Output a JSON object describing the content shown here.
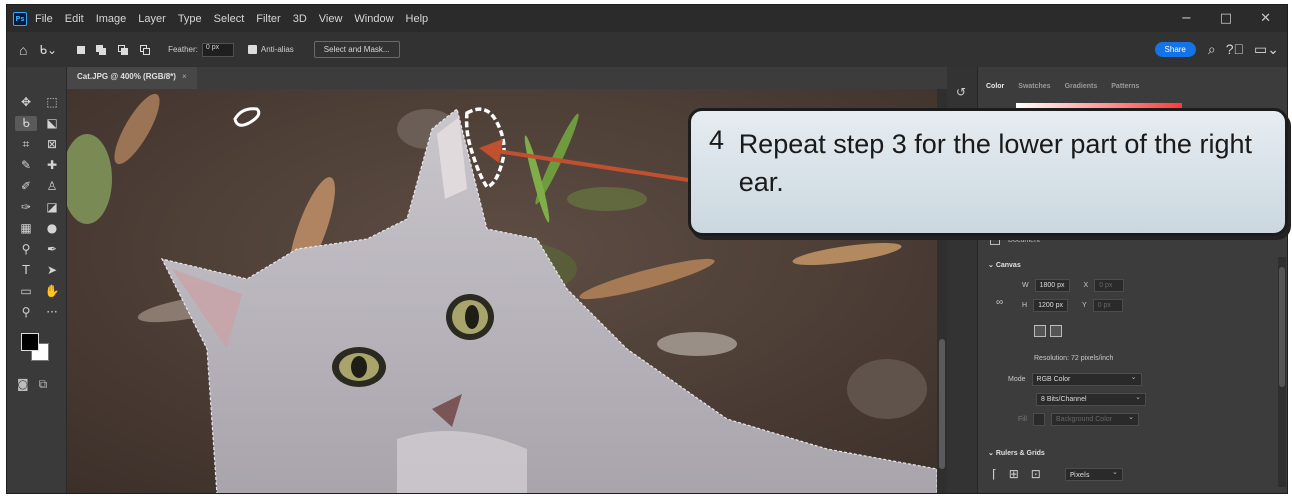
{
  "app": {
    "logo": "Ps",
    "menu": [
      "File",
      "Edit",
      "Image",
      "Layer",
      "Type",
      "Select",
      "Filter",
      "3D",
      "View",
      "Window",
      "Help"
    ],
    "window_controls": [
      "−",
      "□",
      "✕"
    ]
  },
  "options_bar": {
    "feather_label": "Feather:",
    "feather_value": "0 px",
    "anti_alias_label": "Anti-alias",
    "select_mask_label": "Select and Mask...",
    "share_label": "Share"
  },
  "document": {
    "tab_title": "Cat.JPG @ 400% (RGB/8*)",
    "tab_close": "×"
  },
  "panel": {
    "tabs": [
      "Color",
      "Swatches",
      "Gradients",
      "Patterns"
    ],
    "document_label": "Document",
    "canvas_header": "Canvas",
    "width_label": "W",
    "width_value": "1800 px",
    "height_label": "H",
    "height_value": "1200 px",
    "x_label": "X",
    "x_value": "0 px",
    "y_label": "Y",
    "y_value": "0 px",
    "resolution": "Resolution: 72 pixels/inch",
    "mode_label": "Mode",
    "mode_value": "RGB Color",
    "bits_value": "8 Bits/Channel",
    "fill_label": "Fill",
    "fill_value": "Background Color",
    "rulers_header": "Rulers & Grids",
    "units_value": "Pixels"
  },
  "callout": {
    "step_number": "4",
    "text": "Repeat step 3 for the lower part of the right ear."
  },
  "colors": {
    "accent": "#1473e6",
    "arrow": "#c0502e",
    "callout_bg": "#d6e0e7"
  }
}
